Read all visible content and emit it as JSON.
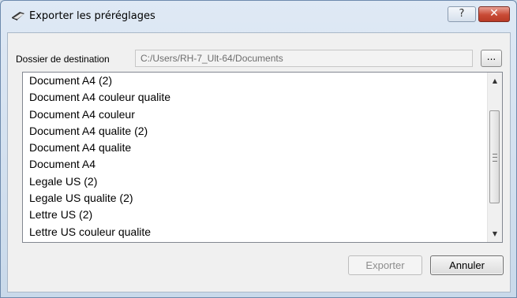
{
  "window": {
    "title": "Exporter les préréglages",
    "help_label": "?",
    "close_label": "✕"
  },
  "destination": {
    "label": "Dossier de destination",
    "path": "C:/Users/RH-7_Ult-64/Documents",
    "browse_label": "..."
  },
  "presets": {
    "items": [
      "Document A4 (2)",
      "Document A4 couleur qualite",
      "Document A4 couleur",
      "Document A4 qualite (2)",
      "Document A4 qualite",
      "Document A4",
      "Legale US  (2)",
      "Legale US qualite (2)",
      "Lettre US (2)",
      "Lettre US couleur qualite"
    ]
  },
  "buttons": {
    "export_label": "Exporter",
    "cancel_label": "Annuler"
  }
}
